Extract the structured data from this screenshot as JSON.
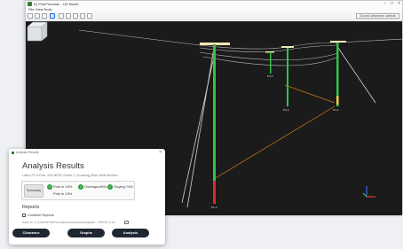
{
  "app": {
    "title": "IQ PoleForeman - US Model",
    "window_controls": [
      "–",
      "□",
      "×"
    ],
    "menu": [
      "File",
      "View",
      "Tools"
    ],
    "toolbar": {
      "tools": [
        "open-icon",
        "save-icon",
        "undo-icon",
        "pole-view-icon",
        "pan-icon",
        "orbit-icon",
        "zoom-icon",
        "measure-icon",
        "settings-icon"
      ],
      "clear_label": "Ground clearance controls"
    }
  },
  "viewport": {
    "background": "#1b1b1b",
    "view_cube": {
      "face": "East",
      "side": "N"
    },
    "pole_labels": [
      "P1-A",
      "P2-A",
      "P3-A",
      "P4-A"
    ]
  },
  "dialog": {
    "title": "Analysis Results",
    "window_title": "Analysis Results",
    "subtext": "Label: P1-A   Pole: 40/3   NESC Grade C (Crossing)   Rule 250B   Medium",
    "summary_label": "Summary",
    "results": [
      {
        "label": "Pole in 24%",
        "status": "pass"
      },
      {
        "label": "Overlaps 85%",
        "status": "pass"
      },
      {
        "label": "Guying 74%",
        "status": "pass"
      },
      {
        "label": "Pole in 13%",
        "status": "pass"
      }
    ],
    "reports_title": "Reports",
    "combine_label": "Combine Reports",
    "save_path": "Save to:  C:\\Users\\PoleForeman\\Documents\\Analysis - WOOD 2.xls",
    "buttons": [
      "Clearance",
      "Graphs",
      "Analysis"
    ]
  },
  "colors": {
    "pole_green": "#33c24a",
    "pole_red": "#e02828",
    "conductor": "#bfbfbf",
    "guy_orange": "#c57a1a",
    "button_dark": "#1f2732"
  }
}
